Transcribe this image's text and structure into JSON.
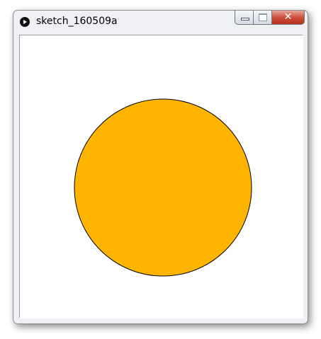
{
  "window": {
    "title": "sketch_160509a",
    "icon": "processing-play-icon",
    "controls": {
      "minimize_icon": "minimize-icon",
      "maximize_icon": "maximize-icon",
      "close_icon": "close-icon",
      "close_glyph": "✕"
    }
  },
  "canvas": {
    "background": "#ffffff",
    "shape": "circle",
    "fill": "#ffb400",
    "stroke": "#000000"
  }
}
